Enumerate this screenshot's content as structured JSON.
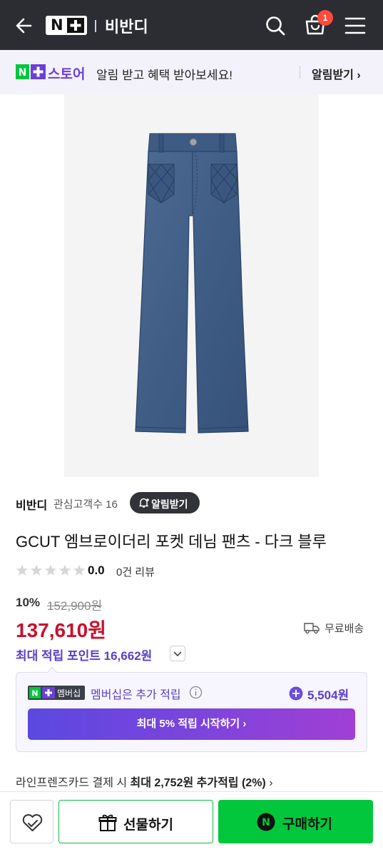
{
  "header": {
    "logo_n": "N",
    "store_name": "비반디",
    "cart_count": "1",
    "bg_color": "#2b2d33"
  },
  "notice": {
    "brand": "스토어",
    "text": "알림 받고 혜택 받아보세요!",
    "link": "알림받기 ›"
  },
  "product": {
    "image": "denim-wide-pants-photo",
    "store_name": "비반디",
    "interest_count": "관심고객수 16",
    "alarm_label": "알림받기",
    "title": "GCUT 엠브로이더리 포켓 데님 팬츠 - 다크 블루",
    "rating": "0.0",
    "review_count": "0건 리뷰",
    "stars_filled": 0,
    "stars_total": 5,
    "discount_rate": "10%",
    "original_price": "152,900원",
    "sale_price": "137,610원",
    "price_color": "#c8102e",
    "shipping": "무료배송",
    "max_points": "최대 적립 포인트 16,662원"
  },
  "membership": {
    "tag_label": "멤버십",
    "text": "멤버십은 추가 적립",
    "amount": "5,504원",
    "cta_label": "최대 5% 적립 시작하기 ›",
    "accent_color": "#5c3fc8"
  },
  "card_benefit": {
    "prefix": "라인프렌즈카드 결제 시 ",
    "highlight": "최대 2,752원 추가적립 (2%)",
    "suffix": " ›"
  },
  "bottom_bar": {
    "gift_label": "선물하기",
    "buy_label": "구매하기",
    "buy_color": "#02c73c"
  }
}
